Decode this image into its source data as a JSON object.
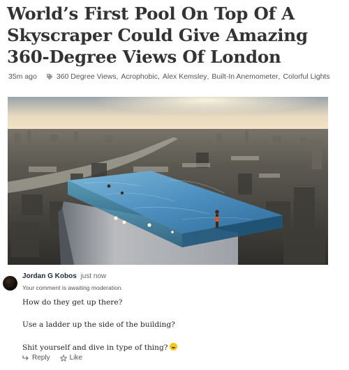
{
  "article": {
    "title": "World’s First Pool On Top Of A Skyscraper Could Give Amazing 360-Degree Views Of London",
    "time_ago": "35m ago",
    "tag_icon": "tag-icon",
    "tags": [
      "360 Degree Views",
      "Acrophobic",
      "Alex Kemsley",
      "Built-In Anemometer",
      "Colorful Lights"
    ]
  },
  "comment": {
    "author": "Jordan G Kobos",
    "time": "just now",
    "moderation": "Your comment is awaiting moderation.",
    "lines": [
      "How do they get up there?",
      "Use a ladder up the side of the building?",
      "Shit yourself and dive in type of thing?"
    ],
    "emoji": "rolling-on-floor-laughing-emoji",
    "reply_label": "Reply",
    "like_label": "Like"
  }
}
